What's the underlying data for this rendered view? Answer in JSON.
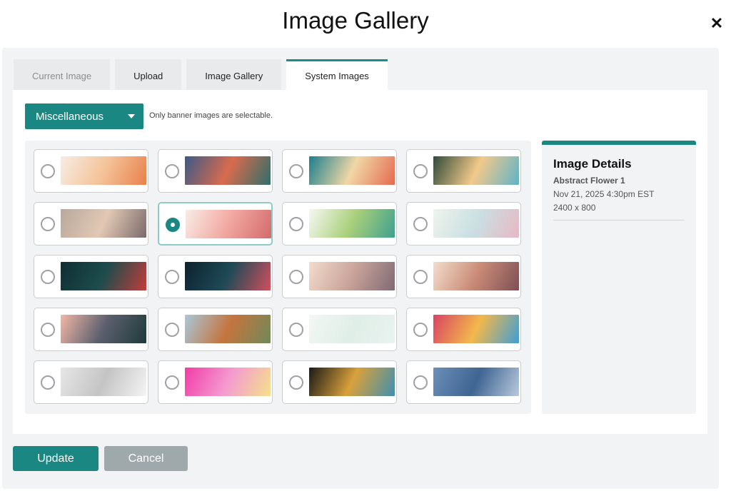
{
  "dialog": {
    "title": "Image Gallery",
    "close_glyph": "✕"
  },
  "tabs": [
    {
      "label": "Current Image",
      "state": "disabled"
    },
    {
      "label": "Upload",
      "state": "normal"
    },
    {
      "label": "Image Gallery",
      "state": "normal"
    },
    {
      "label": "System Images",
      "state": "active"
    }
  ],
  "filter": {
    "selected": "Miscellaneous",
    "hint": "Only banner images are selectable."
  },
  "images": [
    {
      "name": "autumn-leaves",
      "selected": false,
      "colors": [
        "#f6ece4",
        "#f4c39a",
        "#e8804a"
      ]
    },
    {
      "name": "winter-forest",
      "selected": false,
      "colors": [
        "#3c5a86",
        "#d96b4d",
        "#2f6f6a"
      ]
    },
    {
      "name": "beach-aerial",
      "selected": false,
      "colors": [
        "#1b7f8d",
        "#f0d7a6",
        "#e46a4f"
      ]
    },
    {
      "name": "tropical-beach",
      "selected": false,
      "colors": [
        "#2f4b3a",
        "#f2c98a",
        "#5fb3c8"
      ]
    },
    {
      "name": "city-skyline",
      "selected": false,
      "colors": [
        "#b8a89c",
        "#e2c8b4",
        "#7a6a6a"
      ]
    },
    {
      "name": "abstract-flower-1",
      "selected": true,
      "colors": [
        "#f8ece6",
        "#f1a7a0",
        "#d36b6b"
      ]
    },
    {
      "name": "green-leaves",
      "selected": false,
      "colors": [
        "#f6f8f2",
        "#a9cf7a",
        "#3fa08e"
      ]
    },
    {
      "name": "pastel-flowers",
      "selected": false,
      "colors": [
        "#eef3ec",
        "#c9dfe2",
        "#e7b8c3"
      ]
    },
    {
      "name": "dark-floral-teal",
      "selected": false,
      "colors": [
        "#0f2f33",
        "#1e4c4c",
        "#c43c3c"
      ]
    },
    {
      "name": "dark-floral-navy",
      "selected": false,
      "colors": [
        "#0d2230",
        "#1f4a57",
        "#d24f5f"
      ]
    },
    {
      "name": "desert-mountains",
      "selected": false,
      "colors": [
        "#f2dccb",
        "#c9a39a",
        "#7f6a74"
      ]
    },
    {
      "name": "sunset-mountains",
      "selected": false,
      "colors": [
        "#f3dccc",
        "#c98b77",
        "#7e4f55"
      ]
    },
    {
      "name": "mountain-lake",
      "selected": false,
      "colors": [
        "#f2b6a6",
        "#5b5f6e",
        "#1f3a3a"
      ]
    },
    {
      "name": "sports-stadium",
      "selected": false,
      "colors": [
        "#a9c7d9",
        "#c4743e",
        "#6f8a5a"
      ]
    },
    {
      "name": "light-map",
      "selected": false,
      "colors": [
        "#f3f7f4",
        "#dfeee7",
        "#e9f2ef"
      ]
    },
    {
      "name": "rainbow-gradient",
      "selected": false,
      "colors": [
        "#d94363",
        "#f2b84b",
        "#3f9ed6"
      ]
    },
    {
      "name": "silver-lines",
      "selected": false,
      "colors": [
        "#e6e6e6",
        "#c4c4c4",
        "#f4f4f4"
      ]
    },
    {
      "name": "pink-gradient",
      "selected": false,
      "colors": [
        "#f13ca6",
        "#f49ad0",
        "#f5e08a"
      ]
    },
    {
      "name": "gold-bokeh",
      "selected": false,
      "colors": [
        "#1b1a18",
        "#d8a13a",
        "#3e8fb0"
      ]
    },
    {
      "name": "blue-watercolor",
      "selected": false,
      "colors": [
        "#6d8fb8",
        "#3f6592",
        "#b9c9dc"
      ]
    }
  ],
  "details": {
    "heading": "Image Details",
    "name": "Abstract Flower 1",
    "date": "Nov 21, 2025 4:30pm EST",
    "dimensions": "2400 x 800"
  },
  "actions": {
    "update": "Update",
    "cancel": "Cancel"
  },
  "theme": {
    "accent": "#1a8782"
  }
}
